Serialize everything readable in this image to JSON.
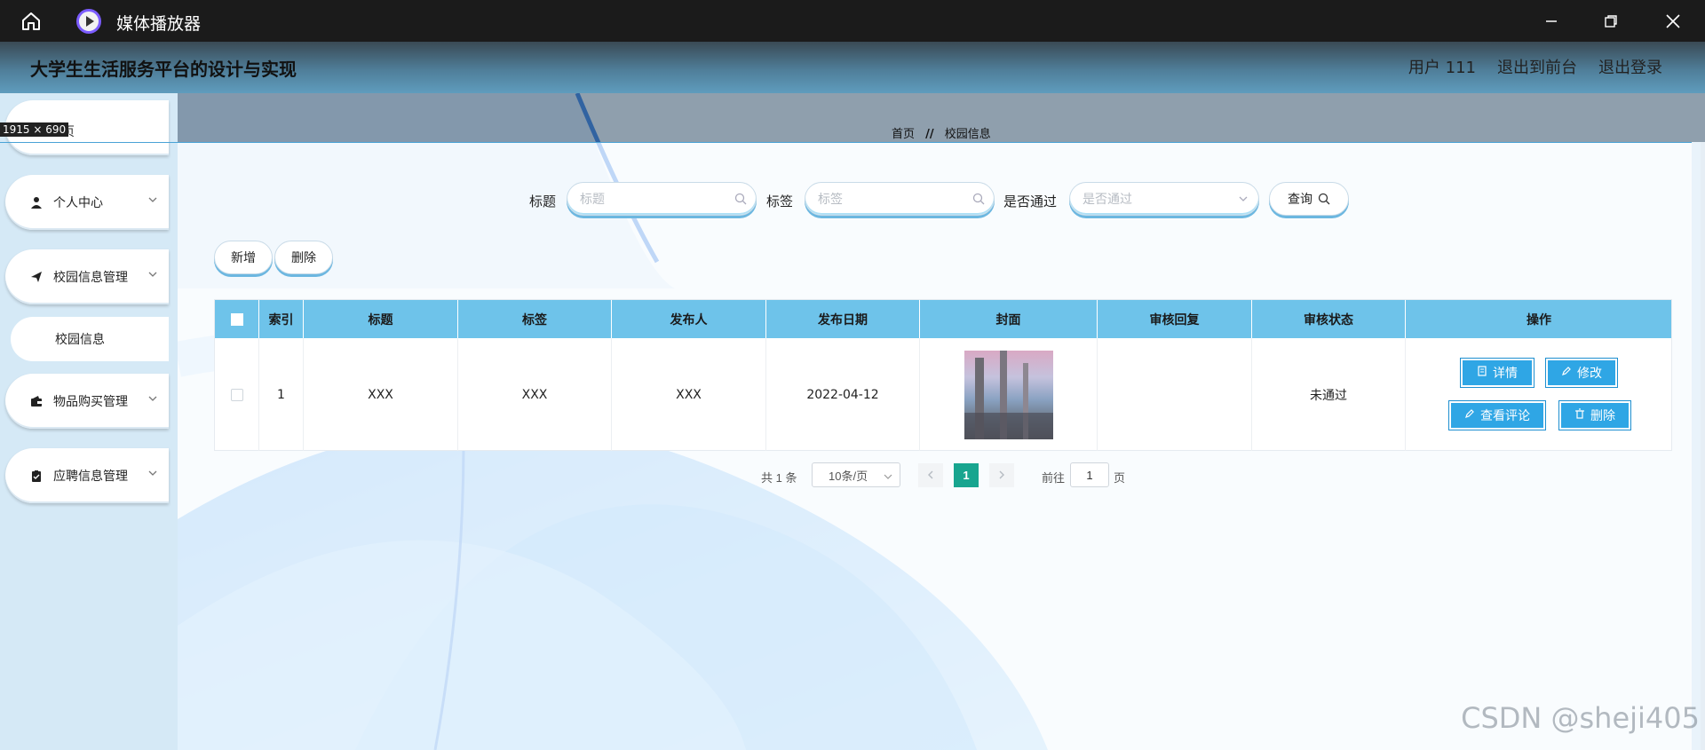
{
  "window": {
    "title": "媒体播放器",
    "icons": [
      "home-icon",
      "media-player-icon",
      "minimize-icon",
      "restore-icon",
      "close-icon"
    ]
  },
  "header": {
    "app_title": "大学生生活服务平台的设计与实现",
    "user": "用户 111",
    "back_front": "退出到前台",
    "logout": "退出登录"
  },
  "overlay": {
    "size_tag": "1915 × 690",
    "partial_home": "页"
  },
  "breadcrumb": {
    "home": "首页",
    "separator": "//",
    "current": "校园信息"
  },
  "sidebar": {
    "items": [
      {
        "label": "个人中心",
        "icon": "user-icon"
      },
      {
        "label": "校园信息管理",
        "icon": "send-icon"
      },
      {
        "label": "物品购买管理",
        "icon": "wallet-icon"
      },
      {
        "label": "应聘信息管理",
        "icon": "clipboard-icon"
      }
    ],
    "sub_items": [
      {
        "label": "校园信息"
      }
    ]
  },
  "search": {
    "title_label": "标题",
    "title_placeholder": "标题",
    "tag_label": "标签",
    "tag_placeholder": "标签",
    "pass_label": "是否通过",
    "pass_placeholder": "是否通过",
    "query_button": "查询"
  },
  "actions": {
    "add": "新增",
    "delete": "删除"
  },
  "table": {
    "columns": [
      "索引",
      "标题",
      "标签",
      "发布人",
      "发布日期",
      "封面",
      "审核回复",
      "审核状态",
      "操作"
    ],
    "rows": [
      {
        "index": "1",
        "title": "XXX",
        "tag": "XXX",
        "publisher": "XXX",
        "date": "2022-04-12",
        "reply": "",
        "status": "未通过",
        "ops": {
          "detail": "详情",
          "edit": "修改",
          "comments": "查看评论",
          "delete": "删除"
        }
      }
    ]
  },
  "pagination": {
    "total": "共 1 条",
    "page_size": "10条/页",
    "current_page": "1",
    "goto_label": "前往",
    "goto_value": "1",
    "page_suffix": "页"
  },
  "watermark": "CSDN @sheji405",
  "colors": {
    "header_bg": "#5f9cbd",
    "table_header": "#6ec3ea",
    "op_button": "#2fa6e5",
    "active_page": "#18a58f"
  }
}
